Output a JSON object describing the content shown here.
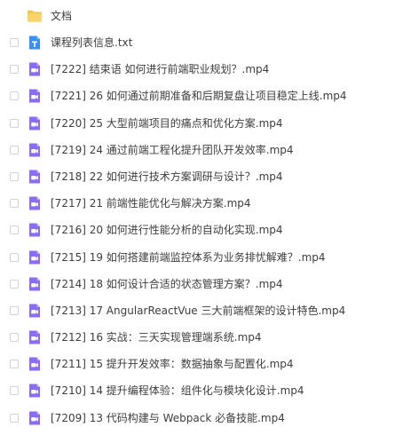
{
  "files": [
    {
      "name": "文档",
      "type": "folder",
      "icon": "folder-icon",
      "selectable": false
    },
    {
      "name": "课程列表信息.txt",
      "type": "text",
      "icon": "text-file-icon",
      "selectable": true
    },
    {
      "name": "[7222] 结束语 如何进行前端职业规划？.mp4",
      "type": "video",
      "icon": "video-file-icon",
      "selectable": true
    },
    {
      "name": "[7221] 26 如何通过前期准备和后期复盘让项目稳定上线.mp4",
      "type": "video",
      "icon": "video-file-icon",
      "selectable": true
    },
    {
      "name": "[7220] 25 大型前端项目的痛点和优化方案.mp4",
      "type": "video",
      "icon": "video-file-icon",
      "selectable": true
    },
    {
      "name": "[7219] 24 通过前端工程化提升团队开发效率.mp4",
      "type": "video",
      "icon": "video-file-icon",
      "selectable": true
    },
    {
      "name": "[7218] 22 如何进行技术方案调研与设计？.mp4",
      "type": "video",
      "icon": "video-file-icon",
      "selectable": true
    },
    {
      "name": "[7217] 21 前端性能优化与解决方案.mp4",
      "type": "video",
      "icon": "video-file-icon",
      "selectable": true
    },
    {
      "name": "[7216] 20 如何进行性能分析的自动化实现.mp4",
      "type": "video",
      "icon": "video-file-icon",
      "selectable": true
    },
    {
      "name": "[7215] 19 如何搭建前端监控体系为业务排忧解难？.mp4",
      "type": "video",
      "icon": "video-file-icon",
      "selectable": true
    },
    {
      "name": "[7214] 18 如何设计合适的状态管理方案？.mp4",
      "type": "video",
      "icon": "video-file-icon",
      "selectable": true
    },
    {
      "name": "[7213] 17 AngularReactVue 三大前端框架的设计特色.mp4",
      "type": "video",
      "icon": "video-file-icon",
      "selectable": true
    },
    {
      "name": "[7212] 16 实战：三天实现管理端系统.mp4",
      "type": "video",
      "icon": "video-file-icon",
      "selectable": true
    },
    {
      "name": "[7211] 15 提升开发效率：数据抽象与配置化.mp4",
      "type": "video",
      "icon": "video-file-icon",
      "selectable": true
    },
    {
      "name": "[7210] 14 提升编程体验：组件化与模块化设计.mp4",
      "type": "video",
      "icon": "video-file-icon",
      "selectable": true
    },
    {
      "name": "[7209] 13 代码构建与 Webpack 必备技能.mp4",
      "type": "video",
      "icon": "video-file-icon",
      "selectable": true
    }
  ],
  "colors": {
    "folder": "#f7c64a",
    "text_file": "#3a8ef6",
    "video_file": "#8b6cf6",
    "checkbox_border": "#cfd3da",
    "text": "#3d3d3d"
  }
}
